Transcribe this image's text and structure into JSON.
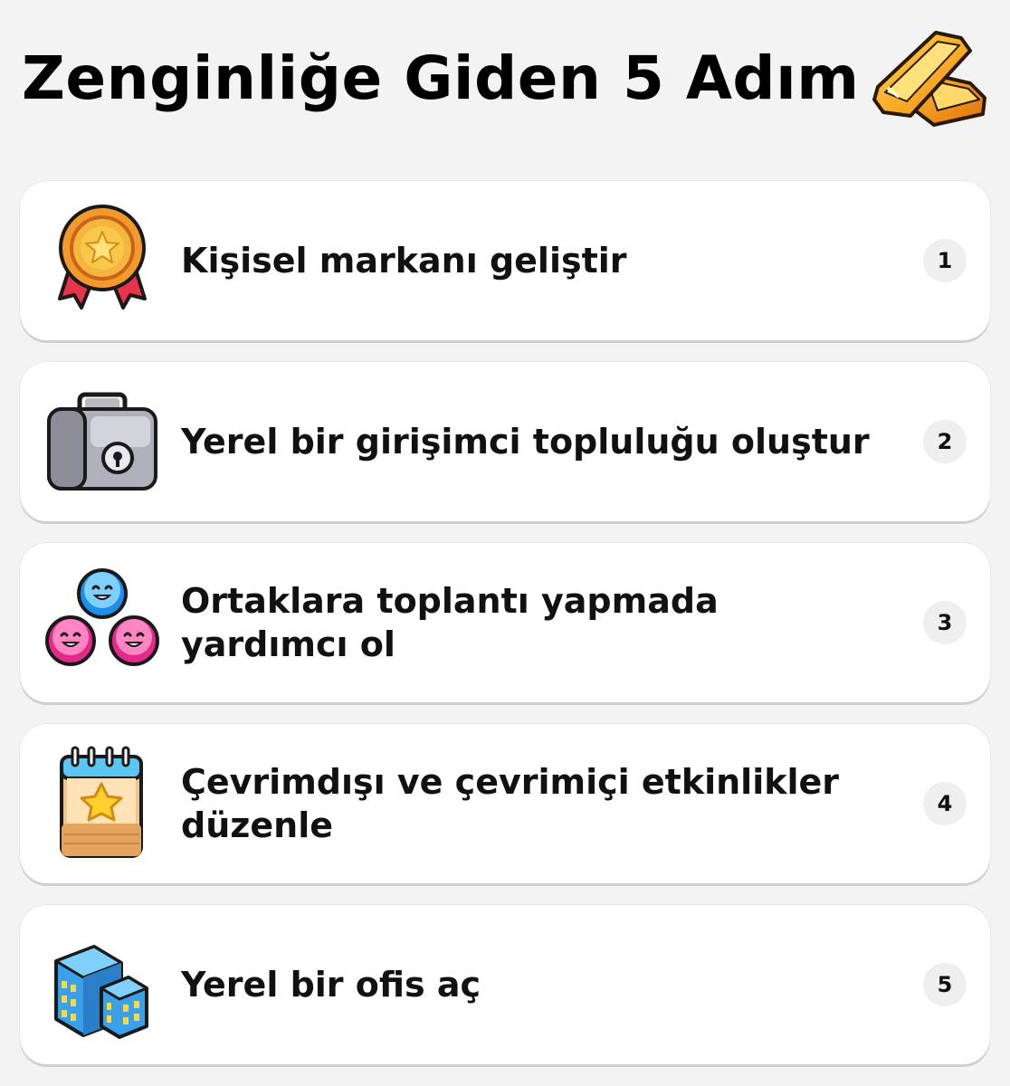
{
  "header": {
    "title": "Zenginliğe Giden 5 Adım",
    "icon": "gold-bars-icon"
  },
  "steps": [
    {
      "label": "Kişisel markanı geliştir",
      "number": "1",
      "icon": "medal-icon"
    },
    {
      "label": "Yerel bir girişimci topluluğu oluştur",
      "number": "2",
      "icon": "briefcase-icon"
    },
    {
      "label": "Ortaklara toplantı yapmada yardımcı ol",
      "number": "3",
      "icon": "people-icon"
    },
    {
      "label": "Çevrimdışı ve çevrimiçi etkinlikler düzenle",
      "number": "4",
      "icon": "calendar-icon"
    },
    {
      "label": "Yerel bir ofis aç",
      "number": "5",
      "icon": "buildings-icon"
    }
  ],
  "colors": {
    "background": "#f3f3f3",
    "card": "#ffffff",
    "badge": "#efefef",
    "gold": "#f7a21b"
  }
}
